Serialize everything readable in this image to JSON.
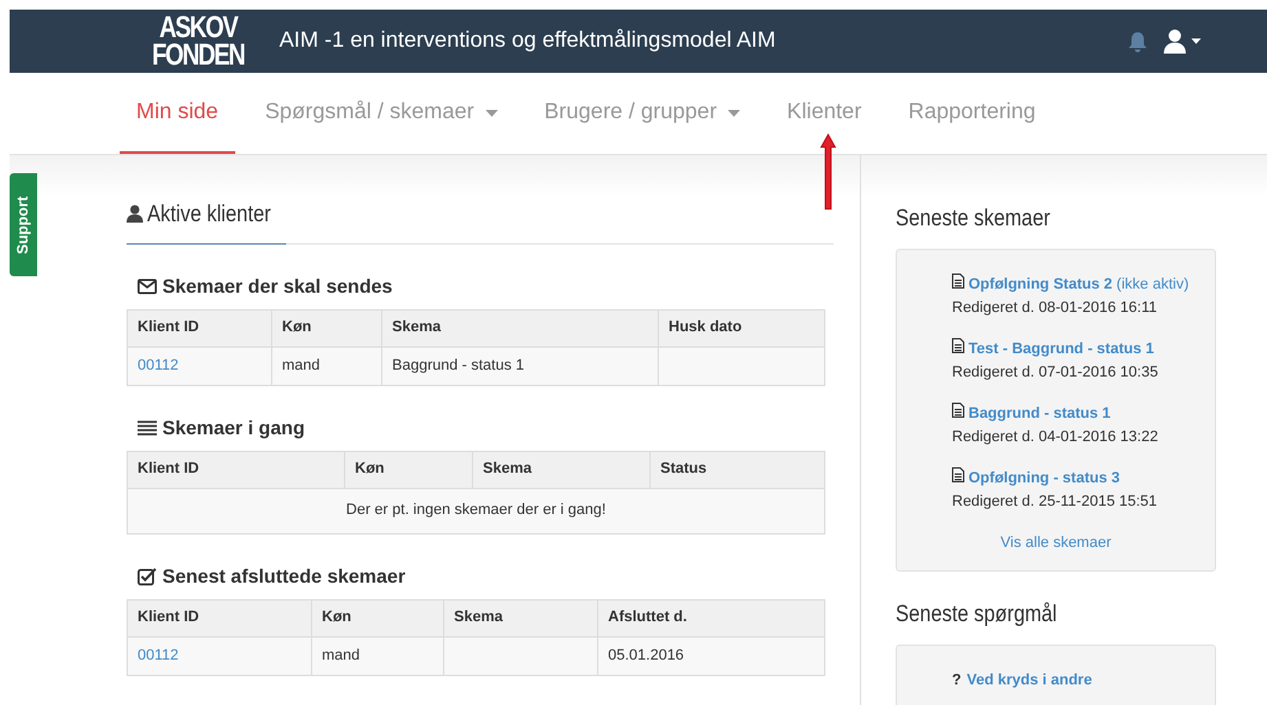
{
  "header": {
    "logo": [
      "ASKOV",
      "FONDEN"
    ],
    "title": "AIM -1 en interventions og effektmålingsmodel AIM"
  },
  "nav": [
    {
      "label": "Min side",
      "selected": true,
      "dropdown": false
    },
    {
      "label": "Spørgsmål / skemaer",
      "selected": false,
      "dropdown": true
    },
    {
      "label": "Brugere / grupper",
      "selected": false,
      "dropdown": true
    },
    {
      "label": "Klienter",
      "selected": false,
      "dropdown": false
    },
    {
      "label": "Rapportering",
      "selected": false,
      "dropdown": false
    }
  ],
  "support_tab": "Support",
  "main": {
    "title": "Aktive klienter",
    "sections": [
      {
        "kind": "envelope",
        "title": "Skemaer der skal sendes",
        "columns": [
          "Klient ID",
          "Køn",
          "Skema",
          "Husk dato"
        ],
        "rows": [
          [
            "00112",
            "mand",
            "Baggrund - status 1",
            ""
          ]
        ]
      },
      {
        "kind": "list",
        "title": "Skemaer i gang",
        "columns": [
          "Klient ID",
          "Køn",
          "Skema",
          "Status"
        ],
        "empty": "Der er pt. ingen skemaer der er i gang!"
      },
      {
        "kind": "check",
        "title": "Senest afsluttede skemaer",
        "columns": [
          "Klient ID",
          "Køn",
          "Skema",
          "Afsluttet d."
        ],
        "rows": [
          [
            "00112",
            "mand",
            "",
            "05.01.2016"
          ]
        ]
      }
    ]
  },
  "sidebar": [
    {
      "title": "Seneste skemaer",
      "items": [
        {
          "kind": "form",
          "name": "Opfølgning Status 2",
          "note": "(ikke aktiv)",
          "edited": "Redigeret d. 08-01-2016 16:11"
        },
        {
          "kind": "form",
          "name": "Test - Baggrund - status 1",
          "edited": "Redigeret d. 07-01-2016 10:35"
        },
        {
          "kind": "form",
          "name": "Baggrund - status 1",
          "edited": "Redigeret d. 04-01-2016 13:22"
        },
        {
          "kind": "form",
          "name": "Opfølgning - status 3",
          "edited": "Redigeret d. 25-11-2015 15:51"
        }
      ],
      "more": "Vis alle skemaer"
    },
    {
      "title": "Seneste spørgmål",
      "items": [
        {
          "kind": "question",
          "mark": "?",
          "name": "Ved kryds i andre"
        }
      ]
    }
  ]
}
